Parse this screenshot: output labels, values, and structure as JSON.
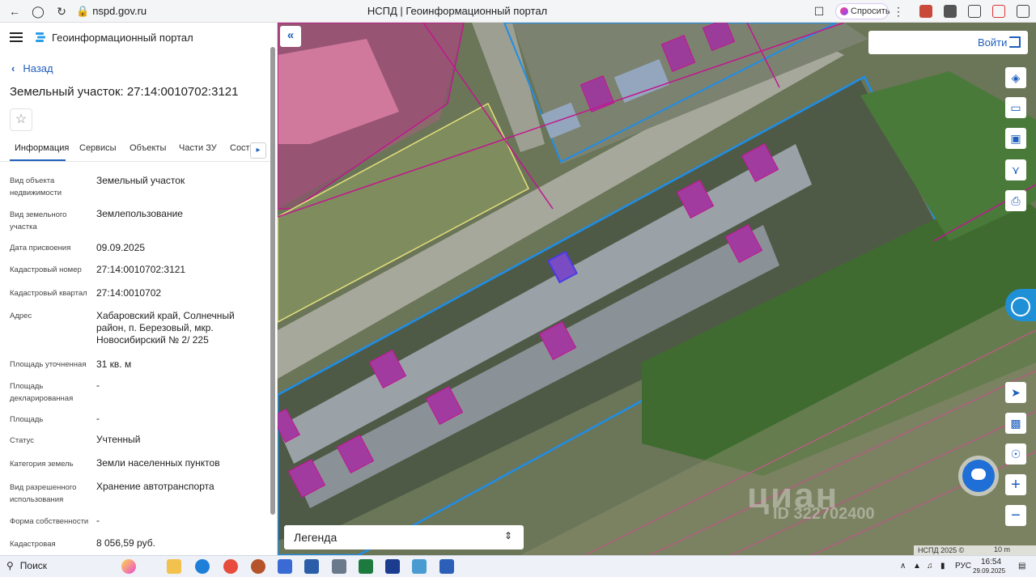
{
  "browser": {
    "url": "nspd.gov.ru",
    "tab_title": "НСПД | Геоинформационный портал",
    "ask_label": "Спросить"
  },
  "sidebar": {
    "portal_title": "Геоинформационный портал",
    "back_label": "Назад",
    "parcel_title": "Земельный участок: 27:14:0010702:3121",
    "tabs": [
      "Информация",
      "Сервисы",
      "Объекты",
      "Части ЗУ",
      "Соста"
    ],
    "active_tab": "Информация",
    "properties": [
      {
        "label": "Вид объекта недвижимости",
        "value": "Земельный участок"
      },
      {
        "label": "Вид земельного участка",
        "value": "Землепользование"
      },
      {
        "label": "Дата присвоения",
        "value": "09.09.2025"
      },
      {
        "label": "Кадастровый номер",
        "value": "27:14:0010702:3121"
      },
      {
        "label": "Кадастровый квартал",
        "value": "27:14:0010702"
      },
      {
        "label": "Адрес",
        "value": "Хабаровский край, Солнечный район, п. Березовый, мкр. Новосибирский № 2/ 225"
      },
      {
        "label": "Площадь уточненная",
        "value": "31 кв. м"
      },
      {
        "label": "Площадь декларированная",
        "value": "-"
      },
      {
        "label": "Площадь",
        "value": "-"
      },
      {
        "label": "Статус",
        "value": "Учтенный"
      },
      {
        "label": "Категория земель",
        "value": "Земли населенных пунктов"
      },
      {
        "label": "Вид разрешенного использования",
        "value": "Хранение автотранспорта"
      },
      {
        "label": "Форма собственности",
        "value": "-"
      },
      {
        "label": "Кадастровая",
        "value": "8 056,59 руб."
      }
    ]
  },
  "map": {
    "login_label": "Войти",
    "legend_label": "Легенда",
    "attribution": "НСПД 2025 ©",
    "scale_label": "10 m",
    "watermark": "циан",
    "watermark_id": "ID 322702400",
    "tools": [
      "layers-icon",
      "ruler-icon",
      "select-area-icon",
      "share-icon",
      "print-icon"
    ],
    "nav_tools": [
      "locate-icon",
      "minimap-icon",
      "geolocation-icon"
    ],
    "colors": {
      "accent": "#1f5fbd",
      "boundary_blue": "#1e8ee8",
      "parcel_magenta": "#c2168f"
    }
  },
  "taskbar": {
    "search_label": "Поиск",
    "language": "РУС",
    "time": "16:54",
    "date": "29.09.2025"
  }
}
